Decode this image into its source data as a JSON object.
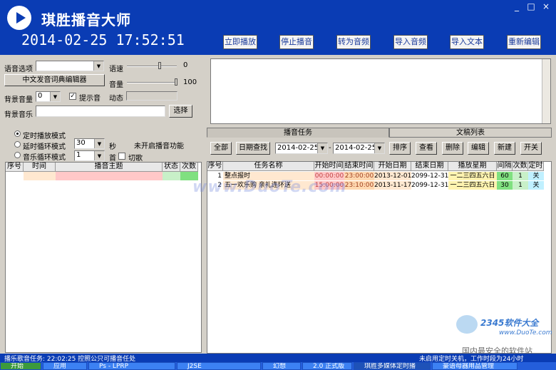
{
  "header": {
    "title": "琪胜播音大师",
    "datetime": "2014-02-25  17:52:51",
    "buttons": [
      "立即播放",
      "停止播音",
      "转为音频",
      "导入音频",
      "导入文本",
      "重新编辑"
    ],
    "window_controls": [
      "_",
      "□",
      "×"
    ]
  },
  "left": {
    "voice_label": "语音选项",
    "speed_label": "语速",
    "speed_value": "0",
    "volume_label": "音量",
    "volume_value": "100",
    "dict_button": "中文发音词典编辑器",
    "bg_volume_label": "背景音量",
    "bg_volume_value": "0",
    "prompt_label": "提示音",
    "prompt_check": "✓",
    "dynamic_label": "动态",
    "bg_music_label": "背景音乐",
    "choose_button": "选择"
  },
  "modes": {
    "timed": "定时播放模式",
    "delay": "延时循环模式",
    "delay_value": "30",
    "delay_unit": "秒",
    "music": "音乐循环模式",
    "music_value": "1",
    "first_label": "首",
    "switch_label": "切歌",
    "status": "未开启播音功能"
  },
  "left_table": {
    "headers": [
      "序号",
      "时间",
      "播音主题",
      "状态",
      "次数"
    ]
  },
  "tabs": {
    "tasks": "播音任务",
    "drafts": "文稿列表"
  },
  "task_toolbar": {
    "all": "全部",
    "date_search": "日期查找",
    "from": "2014-02-25",
    "to": "2014-02-25",
    "sort": "排序",
    "view": "查看",
    "delete": "删除",
    "edit": "编辑",
    "new": "新建",
    "switch": "开关",
    "sep": "-"
  },
  "task_table": {
    "headers": [
      "序号",
      "任务名称",
      "开始时间",
      "结束时间",
      "开始日期",
      "结束日期",
      "播放星期",
      "间隔",
      "次数",
      "定时"
    ],
    "rows": [
      [
        "1",
        "整点报时",
        "00:00:00",
        "23:00:00",
        "2013-12-01",
        "2099-12-31",
        "一二三四五六日",
        "60",
        "1",
        "关"
      ],
      [
        "2",
        "五一欢乐购 亲礼连环送",
        "15:00:00",
        "23:10:00",
        "2013-11-17",
        "2099-12-31",
        "一二三四五六日",
        "30",
        "1",
        "关"
      ]
    ]
  },
  "watermark": "www.DuoTe.com",
  "watermark2": {
    "brand": "2345软件大全",
    "url": "www.DuoTe.com",
    "slogan": "国内最安全的软件站"
  },
  "status_bar": {
    "left": "播乐歌音任务: 22:02:25 控照公只可播音任处",
    "right": "未启用定时关机，工作时段为24小时"
  },
  "taskbar": {
    "start": "开始",
    "items": [
      "动的本页",
      "应用",
      "Ps - LPRP",
      "",
      "J2SE",
      "幻想",
      "2.0 正式版",
      "琪胜多媒体定时播",
      "豪语母器用品管理"
    ]
  },
  "colors": {
    "header": "#0a3cb4",
    "time_pink": "#ffc8c8",
    "time_orange": "#ffd8b0",
    "start_date": "#ffe8d0",
    "week": "#fff4b0",
    "interval": "#80e080",
    "timer": "#c0f0ff"
  }
}
